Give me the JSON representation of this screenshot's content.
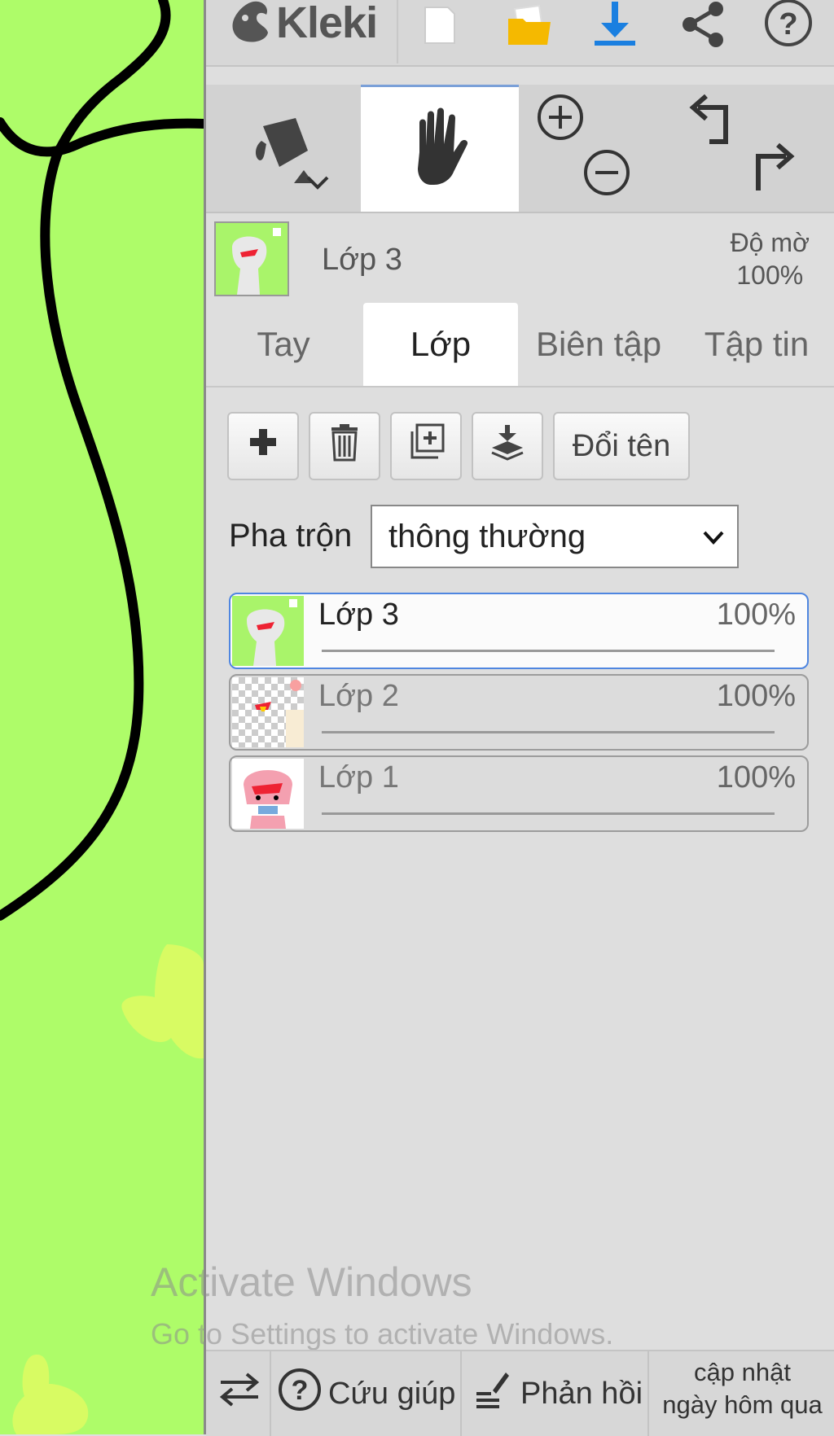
{
  "colors": {
    "canvas": "#aefc69",
    "accent": "#1a7fe0",
    "folder": "#f5b900"
  },
  "app": {
    "logo_text": "Kleki"
  },
  "toolbar": {
    "icons": [
      "kleki-logo-icon",
      "new-document-icon",
      "open-folder-icon",
      "download-icon",
      "share-icon",
      "help-icon"
    ]
  },
  "tools": {
    "fill": "paint-bucket-icon",
    "hand": "hand-icon",
    "zoom_in": "zoom-in-icon",
    "zoom_out": "zoom-out-icon",
    "undo": "undo-icon",
    "redo": "redo-icon"
  },
  "current_layer": {
    "name": "Lớp 3",
    "opacity_label": "Độ mờ",
    "opacity_value": "100%"
  },
  "tabs": [
    "Tay",
    "Lớp",
    "Biên tập",
    "Tập tin"
  ],
  "layer_actions": {
    "rename_label": "Đổi tên"
  },
  "blend": {
    "label": "Pha trộn",
    "value": "thông thường"
  },
  "layers": [
    {
      "name": "Lớp 3",
      "opacity_text": "100%",
      "opacity": 1.0,
      "selected": true
    },
    {
      "name": "Lớp 2",
      "opacity_text": "100%",
      "opacity": 1.0,
      "selected": false
    },
    {
      "name": "Lớp 1",
      "opacity_text": "100%",
      "opacity": 1.0,
      "selected": false
    }
  ],
  "watermark": {
    "line1": "Activate Windows",
    "line2": "Go to Settings to activate Windows."
  },
  "bottom": {
    "help_label": "Cứu giúp",
    "feedback_label": "Phản hồi",
    "update_line1": "cập nhật",
    "update_line2": "ngày hôm qua"
  }
}
